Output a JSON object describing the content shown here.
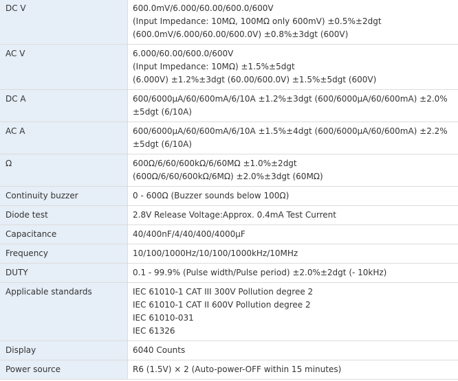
{
  "rows": [
    {
      "label": "DC V",
      "lines": [
        "600.0mV/6.000/60.00/600.0/600V",
        "(Input Impedance: 10MΩ, 100MΩ only 600mV) ±0.5%±2dgt",
        "(600.0mV/6.000/60.00/600.0V) ±0.8%±3dgt (600V)"
      ]
    },
    {
      "label": "AC V",
      "lines": [
        "6.000/60.00/600.0/600V",
        "(Input Impedance: 10MΩ) ±1.5%±5dgt",
        "(6.000V) ±1.2%±3dgt (60.00/600.0V) ±1.5%±5dgt (600V)"
      ]
    },
    {
      "label": "DC A",
      "lines": [
        "600/6000μA/60/600mA/6/10A ±1.2%±3dgt (600/6000μA/60/600mA) ±2.0% ±5dgt (6/10A)"
      ]
    },
    {
      "label": "AC A",
      "lines": [
        "600/6000μA/60/600mA/6/10A ±1.5%±4dgt (600/6000μA/60/600mA) ±2.2% ±5dgt (6/10A)"
      ]
    },
    {
      "label": "Ω",
      "lines": [
        "600Ω/6/60/600kΩ/6/60MΩ ±1.0%±2dgt",
        "(600Ω/6/60/600kΩ/6MΩ) ±2.0%±3dgt (60MΩ)"
      ]
    },
    {
      "label": "Continuity buzzer",
      "lines": [
        "0 - 600Ω (Buzzer sounds below 100Ω)"
      ]
    },
    {
      "label": "Diode test",
      "lines": [
        "2.8V Release Voltage:Approx. 0.4mA Test Current"
      ]
    },
    {
      "label": "Capacitance",
      "lines": [
        "40/400nF/4/40/400/4000μF"
      ]
    },
    {
      "label": "Frequency",
      "lines": [
        "10/100/1000Hz/10/100/1000kHz/10MHz"
      ]
    },
    {
      "label": "DUTY",
      "lines": [
        "0.1 - 99.9% (Pulse width/Pulse period) ±2.0%±2dgt (- 10kHz)"
      ]
    },
    {
      "label": "Applicable standards",
      "lines": [
        "IEC 61010-1 CAT III 300V Pollution degree 2",
        "IEC 61010-1 CAT II 600V Pollution degree 2",
        "IEC 61010-031",
        "IEC 61326"
      ]
    },
    {
      "label": "Display",
      "lines": [
        "6040 Counts"
      ]
    },
    {
      "label": "Power source",
      "lines": [
        "R6 (1.5V) × 2 (Auto-power-OFF within 15 minutes)"
      ]
    }
  ]
}
